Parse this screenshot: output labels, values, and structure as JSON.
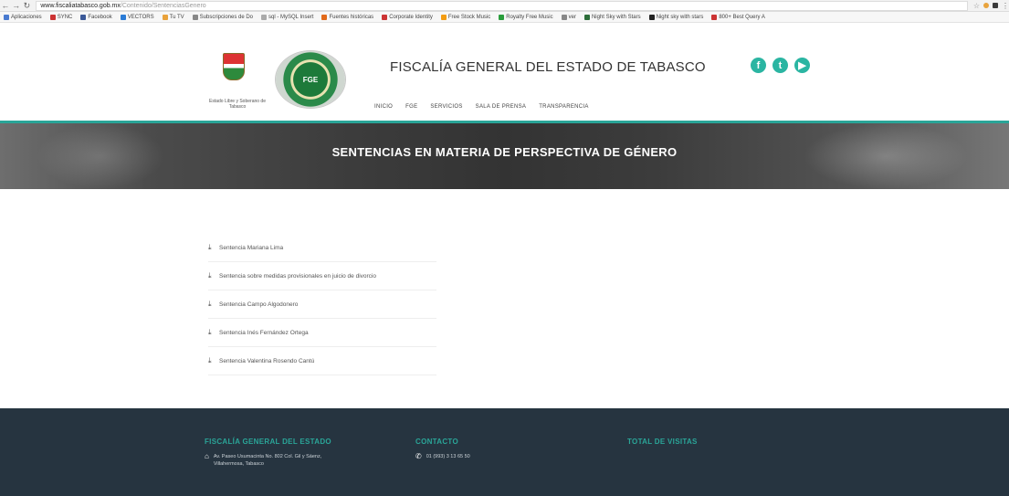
{
  "browser": {
    "url_host": "www.fiscaliatabasco.gob.mx",
    "url_path": "/Contenido/SentenciasGenero",
    "bookmarks": [
      {
        "label": "Aplicaciones",
        "color": "#4a7bd0"
      },
      {
        "label": "SYNC",
        "color": "#c33"
      },
      {
        "label": "Facebook",
        "color": "#3b5998"
      },
      {
        "label": "VECTORS",
        "color": "#2a7bd6"
      },
      {
        "label": "Tu TV",
        "color": "#e9a23b"
      },
      {
        "label": "Subscripciones de Do",
        "color": "#888"
      },
      {
        "label": "sql - MySQL Insert",
        "color": "#aaa"
      },
      {
        "label": "Fuentes históricas",
        "color": "#e26a1a"
      },
      {
        "label": "Corporate Identity",
        "color": "#c33"
      },
      {
        "label": "Free Stock Music",
        "color": "#f39c12"
      },
      {
        "label": "Royalty Free Music",
        "color": "#2a9d3c"
      },
      {
        "label": "ver",
        "color": "#888"
      },
      {
        "label": "Night Sky with Stars",
        "color": "#2d6e3a"
      },
      {
        "label": "Night sky with stars",
        "color": "#222"
      },
      {
        "label": "800+ Best Query A",
        "color": "#c33"
      }
    ]
  },
  "header": {
    "gov_caption": "Estado Libre y Soberano de Tabasco",
    "fge_badge": "FGE",
    "title": "FISCALÍA GENERAL DEL ESTADO DE TABASCO",
    "social": [
      {
        "icon": "facebook-icon",
        "glyph": "f"
      },
      {
        "icon": "twitter-icon",
        "glyph": "t"
      },
      {
        "icon": "youtube-icon",
        "glyph": "▶"
      }
    ],
    "nav": [
      "INICIO",
      "FGE",
      "SERVICIOS",
      "SALA DE PRENSA",
      "TRANSPARENCIA"
    ]
  },
  "banner": {
    "title": "SENTENCIAS EN MATERIA DE PERSPECTIVA DE GÉNERO"
  },
  "documents": [
    "Sentencia Mariana Lima",
    "Sentencia sobre medidas provisionales en juicio de divorcio",
    "Sentencia Campo Algodonero",
    "Sentencia Inés Fernández Ortega",
    "Sentencia Valentina Rosendo Cantú"
  ],
  "footer": {
    "col1_title": "FISCALÍA GENERAL DEL ESTADO",
    "col1_address": "Av. Paseo Usumacinta No. 802 Col. Gil y Sáenz, Villahermosa, Tabasco",
    "col2_title": "CONTACTO",
    "col2_phone": "01 (993) 3 13 65 50",
    "col3_title": "TOTAL DE VISITAS"
  }
}
